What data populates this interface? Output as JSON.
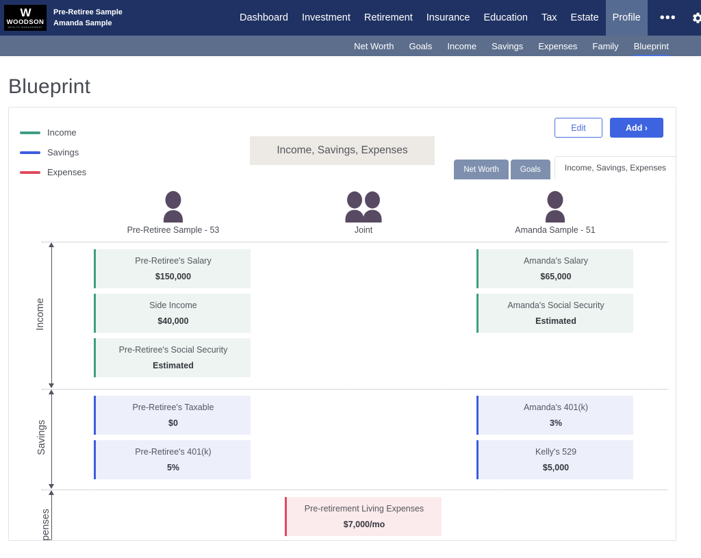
{
  "header": {
    "logo": {
      "mark": "W",
      "name": "WOODSON",
      "tagline": "WEALTH MANAGEMENT"
    },
    "client_name": "Pre-Retiree Sample",
    "client_secondary": "Amanda Sample",
    "nav": [
      {
        "label": "Dashboard",
        "active": false
      },
      {
        "label": "Investment",
        "active": false
      },
      {
        "label": "Retirement",
        "active": false
      },
      {
        "label": "Insurance",
        "active": false
      },
      {
        "label": "Education",
        "active": false
      },
      {
        "label": "Tax",
        "active": false
      },
      {
        "label": "Estate",
        "active": false
      },
      {
        "label": "Profile",
        "active": true
      }
    ],
    "more_label": "•••",
    "accent": "#1f3263",
    "active_nav_bg": "#566b91"
  },
  "subnav": {
    "items": [
      {
        "label": "Net Worth",
        "active": false
      },
      {
        "label": "Goals",
        "active": false
      },
      {
        "label": "Income",
        "active": false
      },
      {
        "label": "Savings",
        "active": false
      },
      {
        "label": "Expenses",
        "active": false
      },
      {
        "label": "Family",
        "active": false
      },
      {
        "label": "Blueprint",
        "active": true
      }
    ],
    "bg": "#5c6e8c",
    "underline": "#4a6fe0"
  },
  "page": {
    "title": "Blueprint"
  },
  "tabs": [
    {
      "label": "Net Worth",
      "active": false
    },
    {
      "label": "Goals",
      "active": false
    },
    {
      "label": "Income, Savings, Expenses",
      "active": true
    }
  ],
  "panel": {
    "chip_label": "Income, Savings, Expenses",
    "edit_label": "Edit",
    "add_label": "Add ›"
  },
  "legend": [
    {
      "label": "Income",
      "color": "#3e9e84"
    },
    {
      "label": "Savings",
      "color": "#3d5ce0"
    },
    {
      "label": "Expenses",
      "color": "#e2485e"
    }
  ],
  "people": [
    {
      "label": "Pre-Retiree Sample - 53",
      "type": "single"
    },
    {
      "label": "Joint",
      "type": "couple"
    },
    {
      "label": "Amanda Sample - 51",
      "type": "single"
    }
  ],
  "sections": [
    {
      "name": "Income",
      "color": "#3e9e84"
    },
    {
      "name": "Savings",
      "color": "#3d5ce0"
    },
    {
      "name": "Expenses",
      "color": "#e2485e"
    }
  ],
  "chart_data": {
    "type": "table",
    "title": "Income, Savings, Expenses",
    "columns": [
      "Pre-Retiree Sample - 53",
      "Joint",
      "Amanda Sample - 51"
    ],
    "rows": [
      {
        "section": "Income",
        "owner": "Pre-Retiree Sample - 53",
        "title": "Pre-Retiree's Salary",
        "value": "$150,000"
      },
      {
        "section": "Income",
        "owner": "Pre-Retiree Sample - 53",
        "title": "Side Income",
        "value": "$40,000"
      },
      {
        "section": "Income",
        "owner": "Pre-Retiree Sample - 53",
        "title": "Pre-Retiree's Social Security",
        "value": "Estimated"
      },
      {
        "section": "Income",
        "owner": "Amanda Sample - 51",
        "title": "Amanda's Salary",
        "value": "$65,000"
      },
      {
        "section": "Income",
        "owner": "Amanda Sample - 51",
        "title": "Amanda's Social Security",
        "value": "Estimated"
      },
      {
        "section": "Savings",
        "owner": "Pre-Retiree Sample - 53",
        "title": "Pre-Retiree's Taxable",
        "value": "$0"
      },
      {
        "section": "Savings",
        "owner": "Pre-Retiree Sample - 53",
        "title": "Pre-Retiree's 401(k)",
        "value": "5%"
      },
      {
        "section": "Savings",
        "owner": "Amanda Sample - 51",
        "title": "Amanda's 401(k)",
        "value": "3%"
      },
      {
        "section": "Savings",
        "owner": "Amanda Sample - 51",
        "title": "Kelly's 529",
        "value": "$5,000"
      },
      {
        "section": "Expenses",
        "owner": "Joint",
        "title": "Pre-retirement Living Expenses",
        "value": "$7,000/mo"
      }
    ]
  },
  "items": {
    "income_left": [
      {
        "title": "Pre-Retiree's Salary",
        "value": "$150,000"
      },
      {
        "title": "Side Income",
        "value": "$40,000"
      },
      {
        "title": "Pre-Retiree's Social Security",
        "value": "Estimated"
      }
    ],
    "income_right": [
      {
        "title": "Amanda's Salary",
        "value": "$65,000"
      },
      {
        "title": "Amanda's Social Security",
        "value": "Estimated"
      }
    ],
    "savings_left": [
      {
        "title": "Pre-Retiree's Taxable",
        "value": "$0"
      },
      {
        "title": "Pre-Retiree's 401(k)",
        "value": "5%"
      }
    ],
    "savings_right": [
      {
        "title": "Amanda's 401(k)",
        "value": "3%"
      },
      {
        "title": "Kelly's 529",
        "value": "$5,000"
      }
    ],
    "expenses_joint": [
      {
        "title": "Pre-retirement Living Expenses",
        "value": "$7,000/mo"
      }
    ]
  }
}
